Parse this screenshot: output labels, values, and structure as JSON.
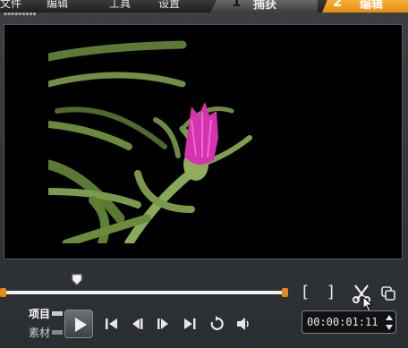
{
  "menu": {
    "file": "文件",
    "edit": "编辑",
    "tools": "工具",
    "settings": "设置"
  },
  "tabs": [
    {
      "number": "1",
      "label": "捕获"
    },
    {
      "number": "2",
      "label": "编辑"
    }
  ],
  "mode": {
    "project": "项目",
    "clip": "素材"
  },
  "timecode": "00:00:01:11",
  "playhead_fraction": 0.26,
  "colors": {
    "accent": "#e8891a",
    "active_tab": "#f0a02a"
  },
  "icons": [
    "play-icon",
    "go-to-start-icon",
    "previous-frame-icon",
    "next-frame-icon",
    "go-to-end-icon",
    "repeat-icon",
    "volume-icon",
    "mark-in-icon",
    "mark-out-icon",
    "cut-scissors-icon",
    "expand-icon",
    "mouse-cursor-icon"
  ]
}
